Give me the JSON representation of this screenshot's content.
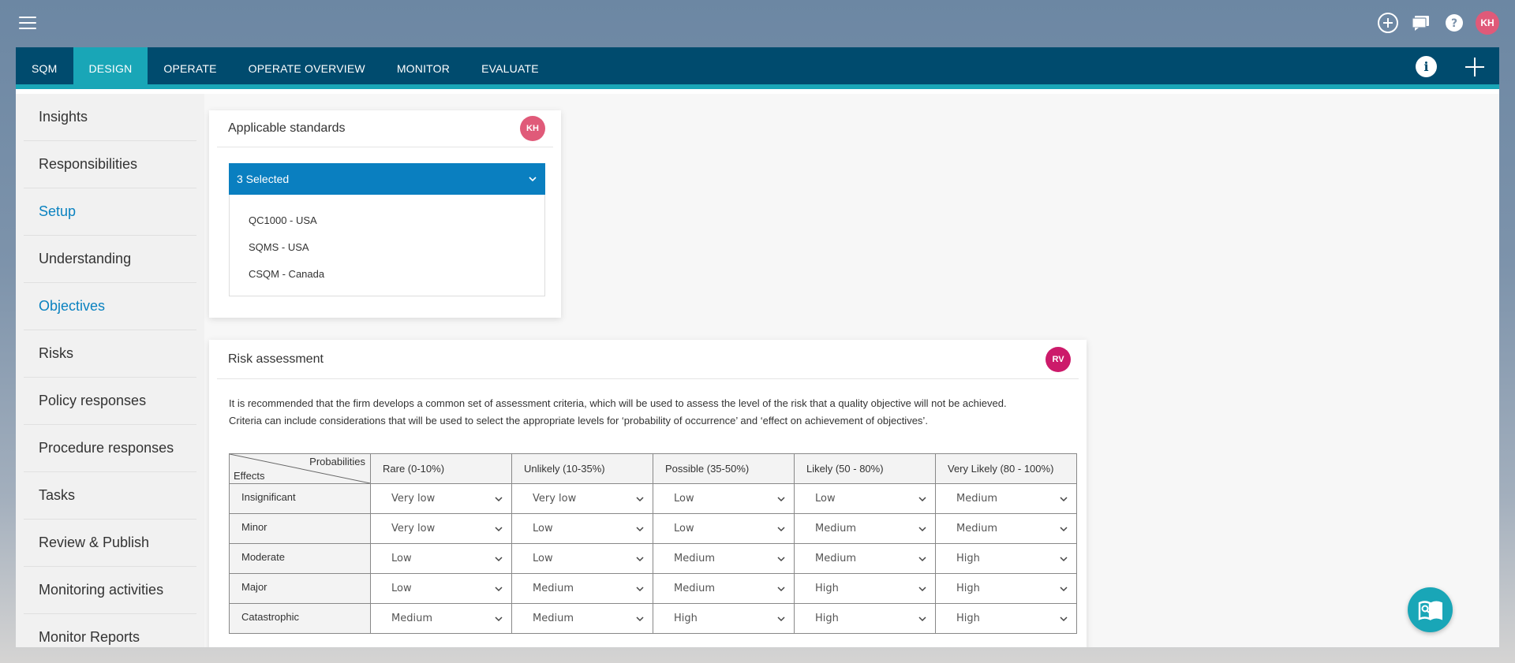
{
  "header": {
    "user_initials": "KH",
    "icons": [
      "add-circle-icon",
      "chat-icon",
      "help-icon"
    ]
  },
  "nav": {
    "tabs": [
      {
        "label": "SQM"
      },
      {
        "label": "DESIGN",
        "active": true
      },
      {
        "label": "OPERATE"
      },
      {
        "label": "OPERATE OVERVIEW"
      },
      {
        "label": "MONITOR"
      },
      {
        "label": "EVALUATE"
      }
    ],
    "info_label": "i"
  },
  "sidebar": {
    "items": [
      {
        "label": "Insights"
      },
      {
        "label": "Responsibilities"
      },
      {
        "label": "Setup",
        "link": true
      },
      {
        "label": "Understanding"
      },
      {
        "label": "Objectives",
        "link": true
      },
      {
        "label": "Risks"
      },
      {
        "label": "Policy responses"
      },
      {
        "label": "Procedure responses"
      },
      {
        "label": "Tasks"
      },
      {
        "label": "Review & Publish"
      },
      {
        "label": "Monitoring activities"
      },
      {
        "label": "Monitor Reports"
      }
    ]
  },
  "standards": {
    "title": "Applicable standards",
    "assignee_initials": "KH",
    "select_value": "3 Selected",
    "options": [
      "QC1000 - USA",
      "SQMS - USA",
      "CSQM - Canada"
    ]
  },
  "risk": {
    "title": "Risk assessment",
    "assignee_initials": "RV",
    "description_line1": "It is recommended that the firm develops a common set of assessment criteria, which will be used to assess the level of the risk that a quality objective will not be achieved.",
    "description_line2": "Criteria can include considerations that will be used to select the appropriate levels for ‘probability of occurrence’ and ‘effect on achievement of objectives’.",
    "corner_probabilities": "Probabilities",
    "corner_effects": "Effects",
    "columns": [
      "Rare (0-10%)",
      "Unlikely (10-35%)",
      "Possible (35-50%)",
      "Likely (50 - 80%)",
      "Very Likely (80 - 100%)"
    ],
    "rows": [
      {
        "effect": "Insignificant",
        "values": [
          "Very low",
          "Very low",
          "Low",
          "Low",
          "Medium"
        ]
      },
      {
        "effect": "Minor",
        "values": [
          "Very low",
          "Low",
          "Low",
          "Medium",
          "Medium"
        ]
      },
      {
        "effect": "Moderate",
        "values": [
          "Low",
          "Low",
          "Medium",
          "Medium",
          "High"
        ]
      },
      {
        "effect": "Major",
        "values": [
          "Low",
          "Medium",
          "Medium",
          "High",
          "High"
        ]
      },
      {
        "effect": "Catastrophic",
        "values": [
          "Medium",
          "Medium",
          "High",
          "High",
          "High"
        ]
      }
    ]
  },
  "colors": {
    "nav_bg": "#004b6e",
    "accent": "#19a6b7",
    "select_bg": "#0a7fc0",
    "link": "#0a82c0"
  }
}
